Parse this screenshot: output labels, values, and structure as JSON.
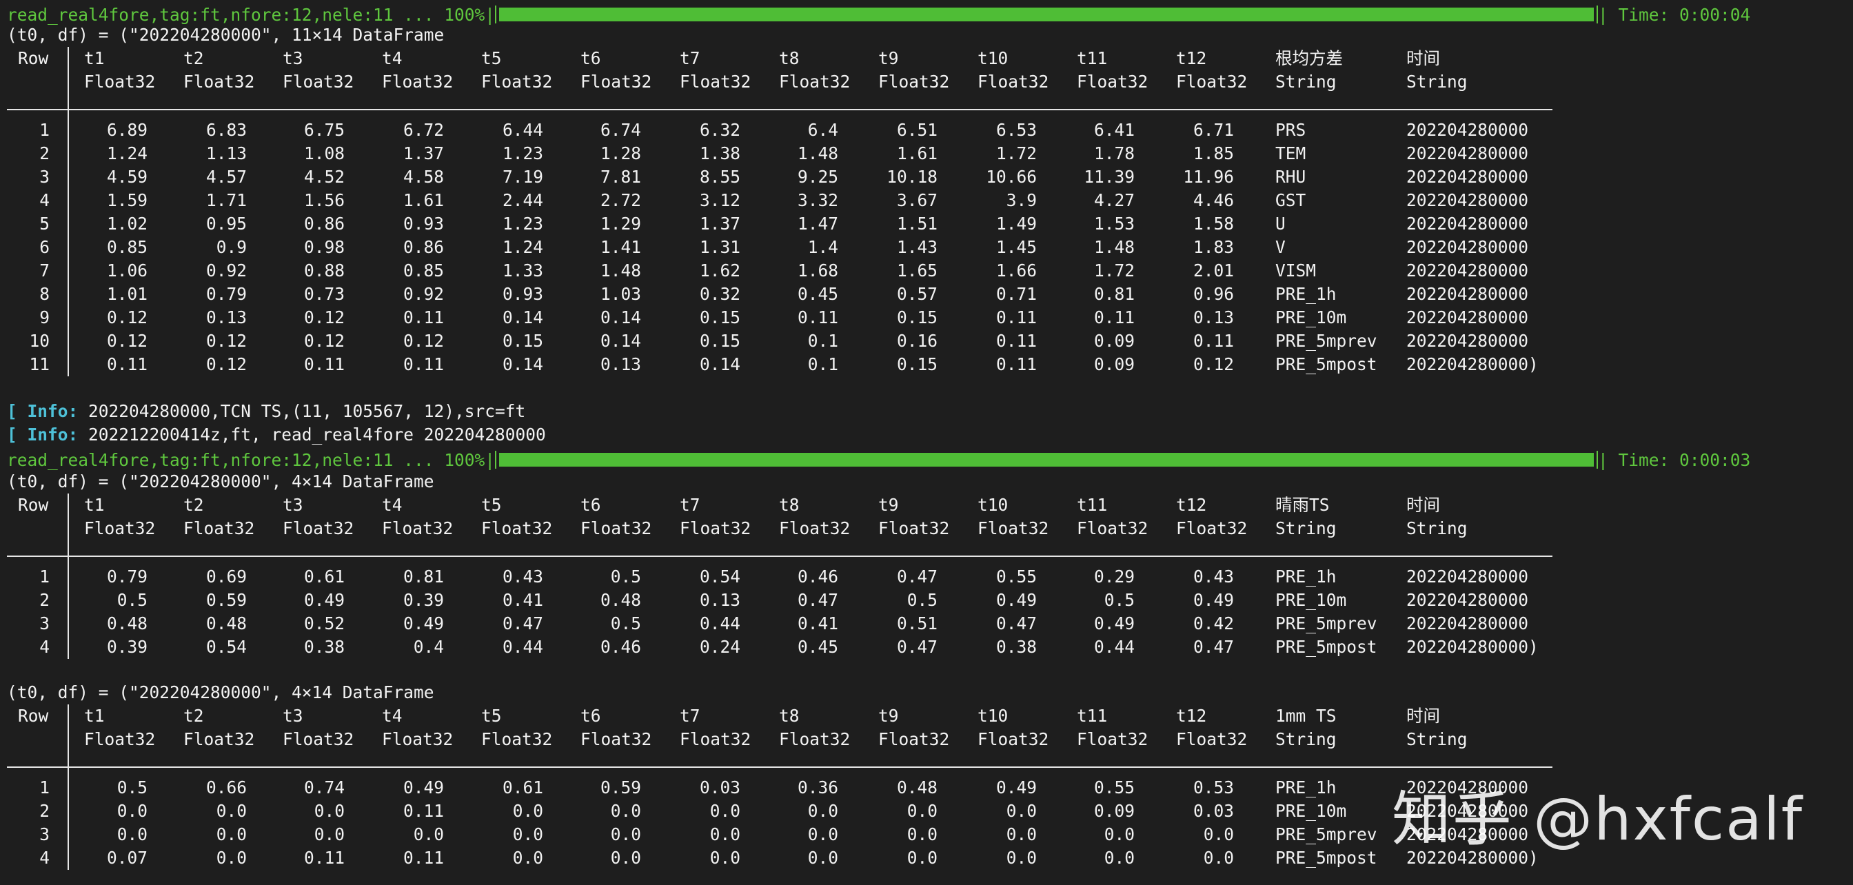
{
  "progress": [
    {
      "label": "read_real4fore,tag:ft,nfore:12,nele:11 ... 100%|",
      "fraction": 1.0,
      "time": "| Time: 0:00:04"
    },
    {
      "label": "read_real4fore,tag:ft,nfore:12,nele:11 ... 100%|",
      "fraction": 1.0,
      "time": "| Time: 0:00:03"
    }
  ],
  "info_lines": [
    {
      "tag": "[ Info:",
      "text": " 202204280000,TCN TS,(11, 105567, 12),src=ft"
    },
    {
      "tag": "[ Info:",
      "text": " 202212200414z,ft, read_real4fore 202204280000"
    }
  ],
  "tables": [
    {
      "header_line": "(t0, df) = (\"202204280000\", 11×14 DataFrame",
      "row_label": "Row",
      "columns": [
        "t1",
        "t2",
        "t3",
        "t4",
        "t5",
        "t6",
        "t7",
        "t8",
        "t9",
        "t10",
        "t11",
        "t12",
        "根均方差",
        "时间"
      ],
      "types": [
        "Float32",
        "Float32",
        "Float32",
        "Float32",
        "Float32",
        "Float32",
        "Float32",
        "Float32",
        "Float32",
        "Float32",
        "Float32",
        "Float32",
        "String",
        "String"
      ],
      "rows": [
        {
          "n": "1",
          "v": [
            "6.89",
            "6.83",
            "6.75",
            "6.72",
            "6.44",
            "6.74",
            "6.32",
            "6.4",
            "6.51",
            "6.53",
            "6.41",
            "6.71"
          ],
          "s": "PRS",
          "t": "202204280000"
        },
        {
          "n": "2",
          "v": [
            "1.24",
            "1.13",
            "1.08",
            "1.37",
            "1.23",
            "1.28",
            "1.38",
            "1.48",
            "1.61",
            "1.72",
            "1.78",
            "1.85"
          ],
          "s": "TEM",
          "t": "202204280000"
        },
        {
          "n": "3",
          "v": [
            "4.59",
            "4.57",
            "4.52",
            "4.58",
            "7.19",
            "7.81",
            "8.55",
            "9.25",
            "10.18",
            "10.66",
            "11.39",
            "11.96"
          ],
          "s": "RHU",
          "t": "202204280000"
        },
        {
          "n": "4",
          "v": [
            "1.59",
            "1.71",
            "1.56",
            "1.61",
            "2.44",
            "2.72",
            "3.12",
            "3.32",
            "3.67",
            "3.9",
            "4.27",
            "4.46"
          ],
          "s": "GST",
          "t": "202204280000"
        },
        {
          "n": "5",
          "v": [
            "1.02",
            "0.95",
            "0.86",
            "0.93",
            "1.23",
            "1.29",
            "1.37",
            "1.47",
            "1.51",
            "1.49",
            "1.53",
            "1.58"
          ],
          "s": "U",
          "t": "202204280000"
        },
        {
          "n": "6",
          "v": [
            "0.85",
            "0.9",
            "0.98",
            "0.86",
            "1.24",
            "1.41",
            "1.31",
            "1.4",
            "1.43",
            "1.45",
            "1.48",
            "1.83"
          ],
          "s": "V",
          "t": "202204280000"
        },
        {
          "n": "7",
          "v": [
            "1.06",
            "0.92",
            "0.88",
            "0.85",
            "1.33",
            "1.48",
            "1.62",
            "1.68",
            "1.65",
            "1.66",
            "1.72",
            "2.01"
          ],
          "s": "VISM",
          "t": "202204280000"
        },
        {
          "n": "8",
          "v": [
            "1.01",
            "0.79",
            "0.73",
            "0.92",
            "0.93",
            "1.03",
            "0.32",
            "0.45",
            "0.57",
            "0.71",
            "0.81",
            "0.96"
          ],
          "s": "PRE_1h",
          "t": "202204280000"
        },
        {
          "n": "9",
          "v": [
            "0.12",
            "0.13",
            "0.12",
            "0.11",
            "0.14",
            "0.14",
            "0.15",
            "0.11",
            "0.15",
            "0.11",
            "0.11",
            "0.13"
          ],
          "s": "PRE_10m",
          "t": "202204280000"
        },
        {
          "n": "10",
          "v": [
            "0.12",
            "0.12",
            "0.12",
            "0.12",
            "0.15",
            "0.14",
            "0.15",
            "0.1",
            "0.16",
            "0.11",
            "0.09",
            "0.11"
          ],
          "s": "PRE_5mprev",
          "t": "202204280000"
        },
        {
          "n": "11",
          "v": [
            "0.11",
            "0.12",
            "0.11",
            "0.11",
            "0.14",
            "0.13",
            "0.14",
            "0.1",
            "0.15",
            "0.11",
            "0.09",
            "0.12"
          ],
          "s": "PRE_5mpost",
          "t": "202204280000)"
        }
      ]
    },
    {
      "header_line": "(t0, df) = (\"202204280000\", 4×14 DataFrame",
      "row_label": "Row",
      "columns": [
        "t1",
        "t2",
        "t3",
        "t4",
        "t5",
        "t6",
        "t7",
        "t8",
        "t9",
        "t10",
        "t11",
        "t12",
        "晴雨TS",
        "时间"
      ],
      "types": [
        "Float32",
        "Float32",
        "Float32",
        "Float32",
        "Float32",
        "Float32",
        "Float32",
        "Float32",
        "Float32",
        "Float32",
        "Float32",
        "Float32",
        "String",
        "String"
      ],
      "rows": [
        {
          "n": "1",
          "v": [
            "0.79",
            "0.69",
            "0.61",
            "0.81",
            "0.43",
            "0.5",
            "0.54",
            "0.46",
            "0.47",
            "0.55",
            "0.29",
            "0.43"
          ],
          "s": "PRE_1h",
          "t": "202204280000"
        },
        {
          "n": "2",
          "v": [
            "0.5",
            "0.59",
            "0.49",
            "0.39",
            "0.41",
            "0.48",
            "0.13",
            "0.47",
            "0.5",
            "0.49",
            "0.5",
            "0.49"
          ],
          "s": "PRE_10m",
          "t": "202204280000"
        },
        {
          "n": "3",
          "v": [
            "0.48",
            "0.48",
            "0.52",
            "0.49",
            "0.47",
            "0.5",
            "0.44",
            "0.41",
            "0.51",
            "0.47",
            "0.49",
            "0.42"
          ],
          "s": "PRE_5mprev",
          "t": "202204280000"
        },
        {
          "n": "4",
          "v": [
            "0.39",
            "0.54",
            "0.38",
            "0.4",
            "0.44",
            "0.46",
            "0.24",
            "0.45",
            "0.47",
            "0.38",
            "0.44",
            "0.47"
          ],
          "s": "PRE_5mpost",
          "t": "202204280000)"
        }
      ]
    },
    {
      "header_line": "(t0, df) = (\"202204280000\", 4×14 DataFrame",
      "row_label": "Row",
      "columns": [
        "t1",
        "t2",
        "t3",
        "t4",
        "t5",
        "t6",
        "t7",
        "t8",
        "t9",
        "t10",
        "t11",
        "t12",
        "1mm TS",
        "时间"
      ],
      "types": [
        "Float32",
        "Float32",
        "Float32",
        "Float32",
        "Float32",
        "Float32",
        "Float32",
        "Float32",
        "Float32",
        "Float32",
        "Float32",
        "Float32",
        "String",
        "String"
      ],
      "rows": [
        {
          "n": "1",
          "v": [
            "0.5",
            "0.66",
            "0.74",
            "0.49",
            "0.61",
            "0.59",
            "0.03",
            "0.36",
            "0.48",
            "0.49",
            "0.55",
            "0.53"
          ],
          "s": "PRE_1h",
          "t": "202204280000"
        },
        {
          "n": "2",
          "v": [
            "0.0",
            "0.0",
            "0.0",
            "0.11",
            "0.0",
            "0.0",
            "0.0",
            "0.0",
            "0.0",
            "0.0",
            "0.09",
            "0.03"
          ],
          "s": "PRE_10m",
          "t": "202204280000"
        },
        {
          "n": "3",
          "v": [
            "0.0",
            "0.0",
            "0.0",
            "0.0",
            "0.0",
            "0.0",
            "0.0",
            "0.0",
            "0.0",
            "0.0",
            "0.0",
            "0.0"
          ],
          "s": "PRE_5mprev",
          "t": "202204280000"
        },
        {
          "n": "4",
          "v": [
            "0.07",
            "0.0",
            "0.11",
            "0.11",
            "0.0",
            "0.0",
            "0.0",
            "0.0",
            "0.0",
            "0.0",
            "0.0",
            "0.0"
          ],
          "s": "PRE_5mpost",
          "t": "202204280000)"
        }
      ]
    }
  ],
  "watermark": "知乎 @hxfcalf",
  "colors": {
    "background": "#1e1e1e",
    "text": "#f2f2f2",
    "progress": "#5fc73e",
    "info": "#4ec1d8"
  }
}
